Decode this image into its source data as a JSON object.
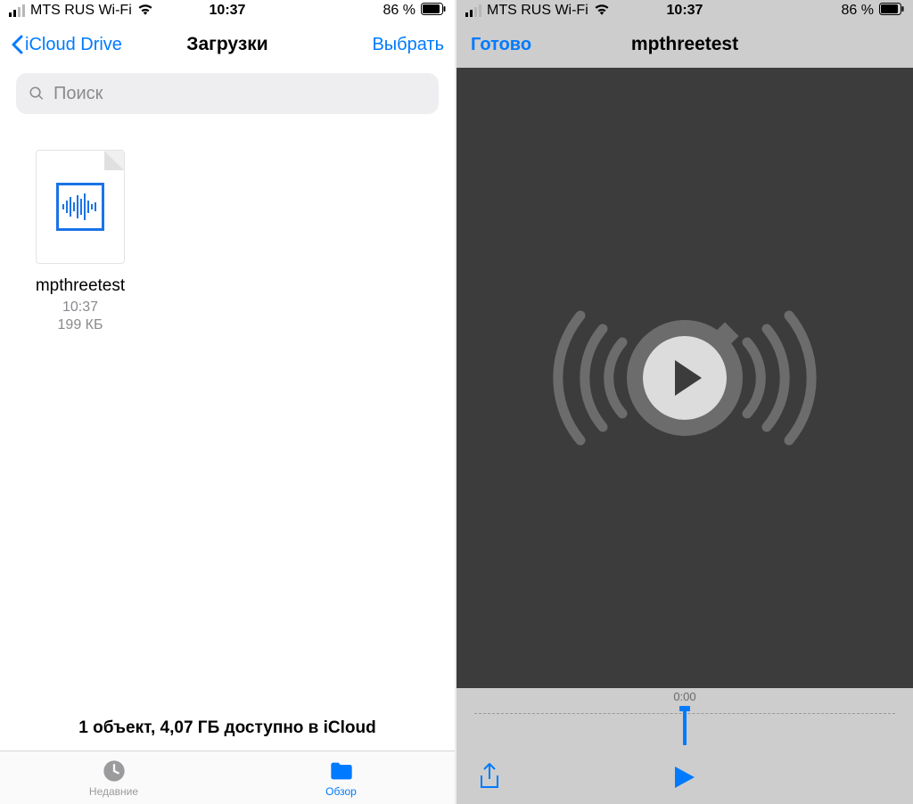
{
  "status": {
    "carrier": "MTS RUS Wi-Fi",
    "time": "10:37",
    "battery": "86 %"
  },
  "left": {
    "nav": {
      "back_label": "iCloud Drive",
      "title": "Загрузки",
      "action_label": "Выбрать"
    },
    "search": {
      "placeholder": "Поиск"
    },
    "file": {
      "name": "mpthreetest",
      "time": "10:37",
      "size": "199 КБ"
    },
    "footer_status": "1 объект, 4,07 ГБ доступно в iCloud",
    "tabs": {
      "recent": "Недавние",
      "browse": "Обзор"
    }
  },
  "right": {
    "nav": {
      "done_label": "Готово",
      "title": "mpthreetest"
    },
    "timeline": {
      "current_time": "0:00"
    }
  }
}
